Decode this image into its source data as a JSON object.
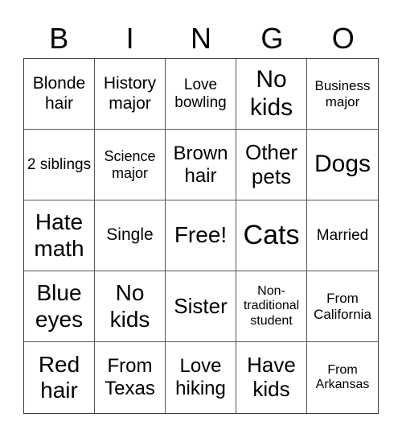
{
  "header": {
    "letters": [
      "B",
      "I",
      "N",
      "G",
      "O"
    ]
  },
  "cells": [
    "Blonde hair",
    "History major",
    "Love bowling",
    "No kids",
    "Business major",
    "2 siblings",
    "Science major",
    "Brown hair",
    "Other pets",
    "Dogs",
    "Hate math",
    "Single",
    "Free!",
    "Cats",
    "Married",
    "Blue eyes",
    "No kids",
    "Sister",
    "Non-traditional student",
    "From California",
    "Red hair",
    "From Texas",
    "Love hiking",
    "Have kids",
    "From Arkansas"
  ]
}
